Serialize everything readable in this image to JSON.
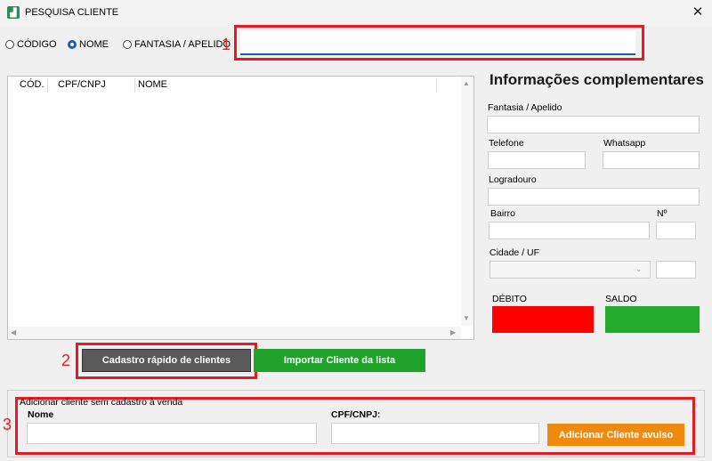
{
  "window": {
    "title": "PESQUISA CLIENTE",
    "icon": "app-logo-icon",
    "close": "✕"
  },
  "search": {
    "options": [
      {
        "label": "CÓDIGO",
        "selected": false
      },
      {
        "label": "NOME",
        "selected": true
      },
      {
        "label": "FANTASIA / APELIDO",
        "selected": false
      }
    ],
    "value": "",
    "placeholder": ""
  },
  "table": {
    "columns": [
      "CÓD.",
      "CPF/CNPJ",
      "NOME"
    ],
    "rows": []
  },
  "info": {
    "title": "Informações complementares",
    "fantasia_label": "Fantasia / Apelido",
    "telefone_label": "Telefone",
    "whatsapp_label": "Whatsapp",
    "logradouro_label": "Logradouro",
    "bairro_label": "Bairro",
    "numero_label": "Nº",
    "cidade_label": "Cidade / UF",
    "debito_label": "DÉBITO",
    "saldo_label": "SALDO"
  },
  "buttons": {
    "quick_register": "Cadastro rápido de clientes",
    "import_client": "Importar Cliente da lista",
    "add_avulso": "Adicionar Cliente avulso"
  },
  "walkin": {
    "title": "Adicionar cliente sem cadastro à venda",
    "nome_label": "Nome",
    "cpf_label": "CPF/CNPJ:"
  },
  "annotations": [
    "1",
    "2",
    "3"
  ],
  "colors": {
    "accent": "#1a5fb4",
    "debito": "#ff0000",
    "saldo": "#22aa2a",
    "import": "#1fa32a",
    "quick": "#595959",
    "avulso": "#f08a0c",
    "annotation": "#e31b23"
  }
}
